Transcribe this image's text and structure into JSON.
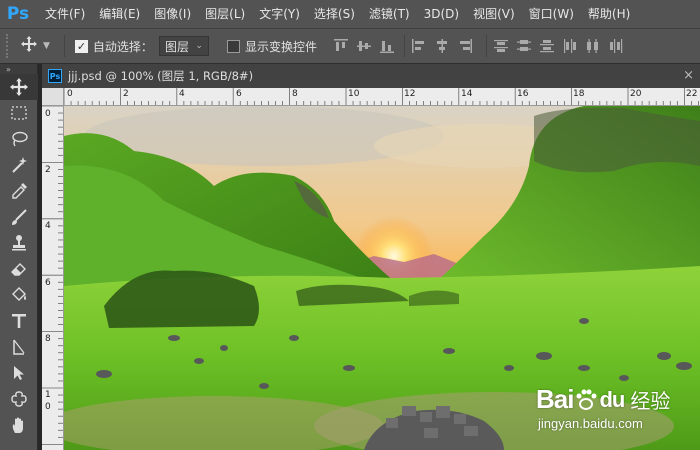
{
  "app": {
    "logo_text": "Ps",
    "menu": [
      "文件(F)",
      "编辑(E)",
      "图像(I)",
      "图层(L)",
      "文字(Y)",
      "选择(S)",
      "滤镜(T)",
      "3D(D)",
      "视图(V)",
      "窗口(W)",
      "帮助(H)"
    ]
  },
  "options_bar": {
    "auto_select_label": "自动选择：",
    "auto_select_checked": true,
    "auto_select_target": "图层",
    "show_transform_label": "显示变换控件",
    "show_transform_checked": false
  },
  "document": {
    "icon_text": "Ps",
    "title": "jjj.psd @ 100% (图层 1, RGB/8#)",
    "ruler_h_labels": [
      "0",
      "2",
      "4",
      "6",
      "8",
      "10",
      "12",
      "14",
      "16",
      "18",
      "20",
      "22"
    ],
    "ruler_v_labels": [
      "0",
      "2",
      "4",
      "6",
      "8",
      "1",
      "0"
    ]
  },
  "watermark": {
    "brand": "Bai",
    "brand_suffix": "du",
    "product": "经验",
    "url": "jingyan.baidu.com"
  },
  "colors": {
    "accent_ps": "#31a8ff",
    "panel_bg": "#535353",
    "canvas_grass": "#6bbf2a"
  }
}
